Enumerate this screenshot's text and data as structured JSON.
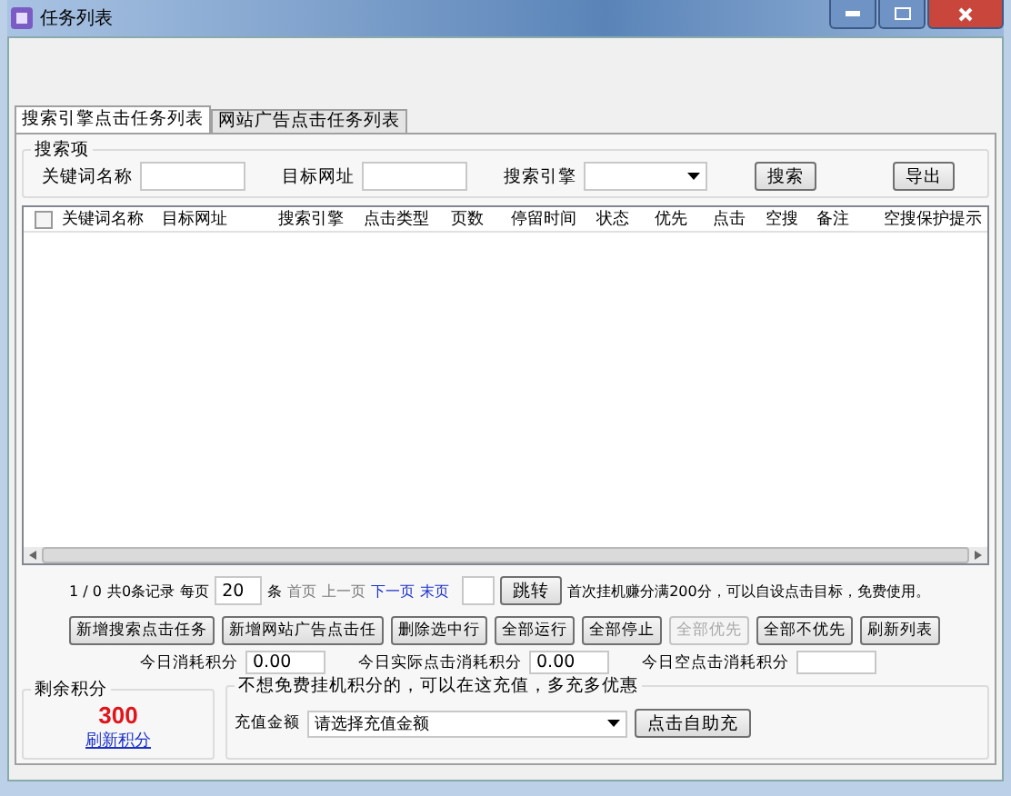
{
  "window": {
    "title": "任务列表"
  },
  "tabs": [
    {
      "label": "搜索引擎点击任务列表",
      "selected": true
    },
    {
      "label": "网站广告点击任务列表",
      "selected": false
    }
  ],
  "search": {
    "group_title": "搜索项",
    "keyword_label": "关键词名称",
    "url_label": "目标网址",
    "engine_label": "搜索引擎",
    "search_button": "搜索",
    "export_button": "导出"
  },
  "table": {
    "select_all_checked": false,
    "columns": [
      "关键词名称",
      "目标网址",
      "搜索引擎",
      "点击类型",
      "页数",
      "停留时间",
      "状态",
      "优先",
      "点击",
      "空搜",
      "备注",
      "空搜保护提示"
    ]
  },
  "pager": {
    "page": "1 / 0",
    "total": "共0条记录",
    "per_page_label": "每页",
    "per_page": "20",
    "unit": "条",
    "links": [
      {
        "label": "首页",
        "disabled": true
      },
      {
        "label": "上一页",
        "disabled": true
      },
      {
        "label": "下一页",
        "disabled": false
      },
      {
        "label": "末页",
        "disabled": false
      }
    ],
    "jump_button": "跳转",
    "notice": "首次挂机赚分满200分，可以自设点击目标，免费使用。"
  },
  "actions": [
    {
      "label": "新增搜索点击任务",
      "disabled": false
    },
    {
      "label": "新增网站广告点击任",
      "disabled": false
    },
    {
      "label": "删除选中行",
      "disabled": false
    },
    {
      "label": "全部运行",
      "disabled": false
    },
    {
      "label": "全部停止",
      "disabled": false
    },
    {
      "label": "全部优先",
      "disabled": true
    },
    {
      "label": "全部不优先",
      "disabled": false
    },
    {
      "label": "刷新列表",
      "disabled": false
    }
  ],
  "stats": [
    {
      "label": "今日消耗积分",
      "value": "0.00"
    },
    {
      "label": "今日实际点击消耗积分",
      "value": "0.00"
    },
    {
      "label": "今日空点击消耗积分"
    }
  ],
  "balance": {
    "title": "剩余积分",
    "points": "300",
    "refresh_link": "刷新积分"
  },
  "recharge": {
    "hint": "不想免费挂机积分的，可以在这充值，多充多优惠",
    "amount_label": "充值金额",
    "amount_placeholder": "请选择充值金额",
    "button": "点击自助充"
  }
}
